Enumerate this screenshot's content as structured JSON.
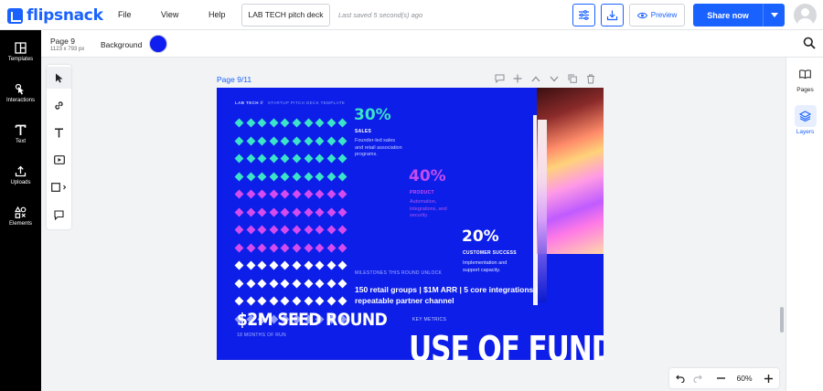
{
  "app": {
    "brand": "flipsnack"
  },
  "menu": [
    "File",
    "View",
    "Help"
  ],
  "header": {
    "document_title": "LAB TECH pitch deck",
    "saved_status": "Last saved 5 second(s) ago",
    "preview_label": "Preview",
    "share_label": "Share now"
  },
  "leftnav": {
    "items": [
      {
        "label": "Templates",
        "icon": "templates-icon"
      },
      {
        "label": "Interactions",
        "icon": "interactions-icon"
      },
      {
        "label": "Text",
        "icon": "text-icon"
      },
      {
        "label": "Uploads",
        "icon": "uploads-icon"
      },
      {
        "label": "Elements",
        "icon": "elements-icon"
      }
    ]
  },
  "subbar": {
    "page_name": "Page 9",
    "page_size": "1123 x 793 px",
    "background_label": "Background",
    "background_color": "#0f1ef0"
  },
  "rightnav": {
    "items": [
      {
        "label": "Pages",
        "icon": "book-icon"
      },
      {
        "label": "Layers",
        "icon": "layers-icon"
      }
    ]
  },
  "canvas": {
    "page_label": "Page 9/11",
    "header_brand": "LAB TECH //",
    "header_sub": "STARTUP PITCH DECK TEMPLATE",
    "stats": [
      {
        "pct": "30%",
        "label": "SALES",
        "desc": "Founder-led sales and retail association programs.",
        "color": "#3be3c9"
      },
      {
        "pct": "40%",
        "label": "PRODUCT",
        "desc": "Automation, integrations, and security.",
        "color": "#c24cf0"
      },
      {
        "pct": "20%",
        "label": "CUSTOMER SUCCESS",
        "desc": "Implementation and support capacity.",
        "color": "#ffffff"
      }
    ],
    "milestones_label": "MILESTONES THIS ROUND UNLOCK",
    "milestones_text": "150 retail groups | $1M ARR | 5 core integrations | repeatable partner channel",
    "seed_title": "$2M SEED ROUND",
    "seed_sub": "18 MONTHS OF RUN",
    "key_metrics_label": "KEY METRICS",
    "funds_title": "USE OF FUNDS",
    "colors": {
      "teal": "#3be3c9",
      "magenta": "#d44cf0",
      "white": "#ffffff",
      "lavender": "#8f9bff"
    }
  },
  "zoom": {
    "level": "60%"
  }
}
